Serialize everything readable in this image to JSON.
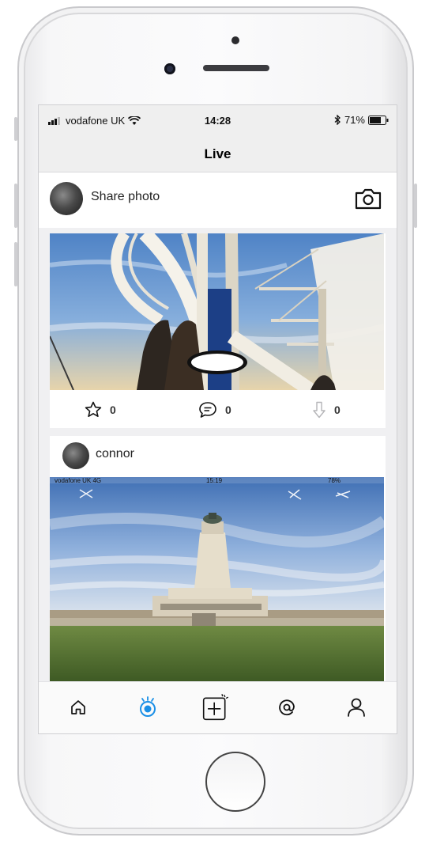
{
  "status_bar": {
    "carrier": "vodafone UK",
    "time": "14:28",
    "battery": "71%",
    "icons": [
      "signal-icon",
      "wifi-icon",
      "bluetooth-icon",
      "battery-icon"
    ]
  },
  "nav": {
    "title": "Live"
  },
  "composer": {
    "label": "Share photo",
    "camera_icon": "camera-icon"
  },
  "posts": [
    {
      "stats": {
        "stars": "0",
        "comments": "0",
        "downloads": "0"
      }
    },
    {
      "username": "connor",
      "embedded_status": {
        "carrier": "vodafone UK  4G",
        "time": "15:19",
        "battery": "78%"
      }
    }
  ],
  "tabbar": {
    "items": [
      {
        "icon": "home-icon",
        "active": false
      },
      {
        "icon": "live-icon",
        "active": true
      },
      {
        "icon": "add-post-icon",
        "active": false
      },
      {
        "icon": "mentions-icon",
        "active": false
      },
      {
        "icon": "profile-icon",
        "active": false
      }
    ],
    "active_color": "#1a8fe6"
  },
  "colors": {
    "accent": "#1a8fe6",
    "header_bg": "#efefef"
  }
}
